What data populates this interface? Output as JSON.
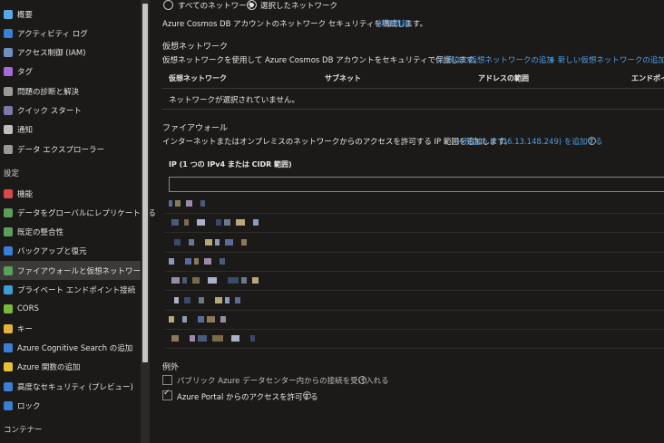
{
  "sidebar": {
    "items": [
      {
        "label": "概要",
        "color": "#5aa9e6"
      },
      {
        "label": "アクティビティ ログ",
        "color": "#3a7fd6"
      },
      {
        "label": "アクセス制御 (IAM)",
        "color": "#6f8fbf"
      },
      {
        "label": "タグ",
        "color": "#a66bd6"
      },
      {
        "label": "問題の診断と解決",
        "color": "#9a9a9a"
      },
      {
        "label": "クイック スタート",
        "color": "#7a7aa8"
      },
      {
        "label": "通知",
        "color": "#bfbfbf"
      },
      {
        "label": "データ エクスプローラー",
        "color": "#9a9a9a"
      }
    ],
    "section_settings": "設定",
    "settings_items": [
      {
        "label": "機能",
        "color": "#d64a4a"
      },
      {
        "label": "データをグローバルにレプリケートする",
        "color": "#5aa05a"
      },
      {
        "label": "既定の整合性",
        "color": "#5aa05a"
      },
      {
        "label": "バックアップと復元",
        "color": "#3a7fd6"
      },
      {
        "label": "ファイアウォールと仮想ネットワーク",
        "color": "#5aa05a"
      },
      {
        "label": "プライベート エンドポイント接続",
        "color": "#3a9fd6"
      },
      {
        "label": "CORS",
        "color": "#7ab83a"
      },
      {
        "label": "キー",
        "color": "#e6b23a"
      },
      {
        "label": "Azure Cognitive Search の追加",
        "color": "#3a7fd6"
      },
      {
        "label": "Azure 関数の追加",
        "color": "#e6c23a"
      },
      {
        "label": "高度なセキュリティ (プレビュー)",
        "color": "#3a7fd6"
      },
      {
        "label": "ロック",
        "color": "#3a7fd6"
      }
    ],
    "section_container": "コンテナー"
  },
  "network": {
    "radio_all": "すべてのネットワーク",
    "radio_selected": "選択したネットワーク",
    "description": "Azure Cosmos DB アカウントのネットワーク セキュリティを構成します。",
    "learn_more": "詳細情報。"
  },
  "vnet": {
    "title": "仮想ネットワーク",
    "description": "仮想ネットワークを使用して Azure Cosmos DB アカウントをセキュリティで保護します。",
    "add_existing": "+ 既存の仮想ネットワークの追加",
    "add_new": "+ 新しい仮想ネットワークの追加",
    "columns": [
      "仮想ネットワーク",
      "サブネット",
      "アドレスの範囲",
      "エンドポイ"
    ],
    "empty": "ネットワークが選択されていません。"
  },
  "firewall": {
    "title": "ファイアウォール",
    "description": "インターネットまたはオンプレミスのネットワークからのアクセスを許可する IP 範囲を追加します。",
    "add_current_ip": "+ 現在の IP (36.13.148.249) を追加する",
    "ip_header": "IP (1 つの IPv4 または CIDR 範囲)",
    "ip_placeholder": ""
  },
  "exceptions": {
    "title": "例外",
    "accept_datacenter": "パブリック Azure データセンター内からの接続を受け入れる",
    "allow_portal": "Azure Portal からのアクセスを許可する"
  }
}
